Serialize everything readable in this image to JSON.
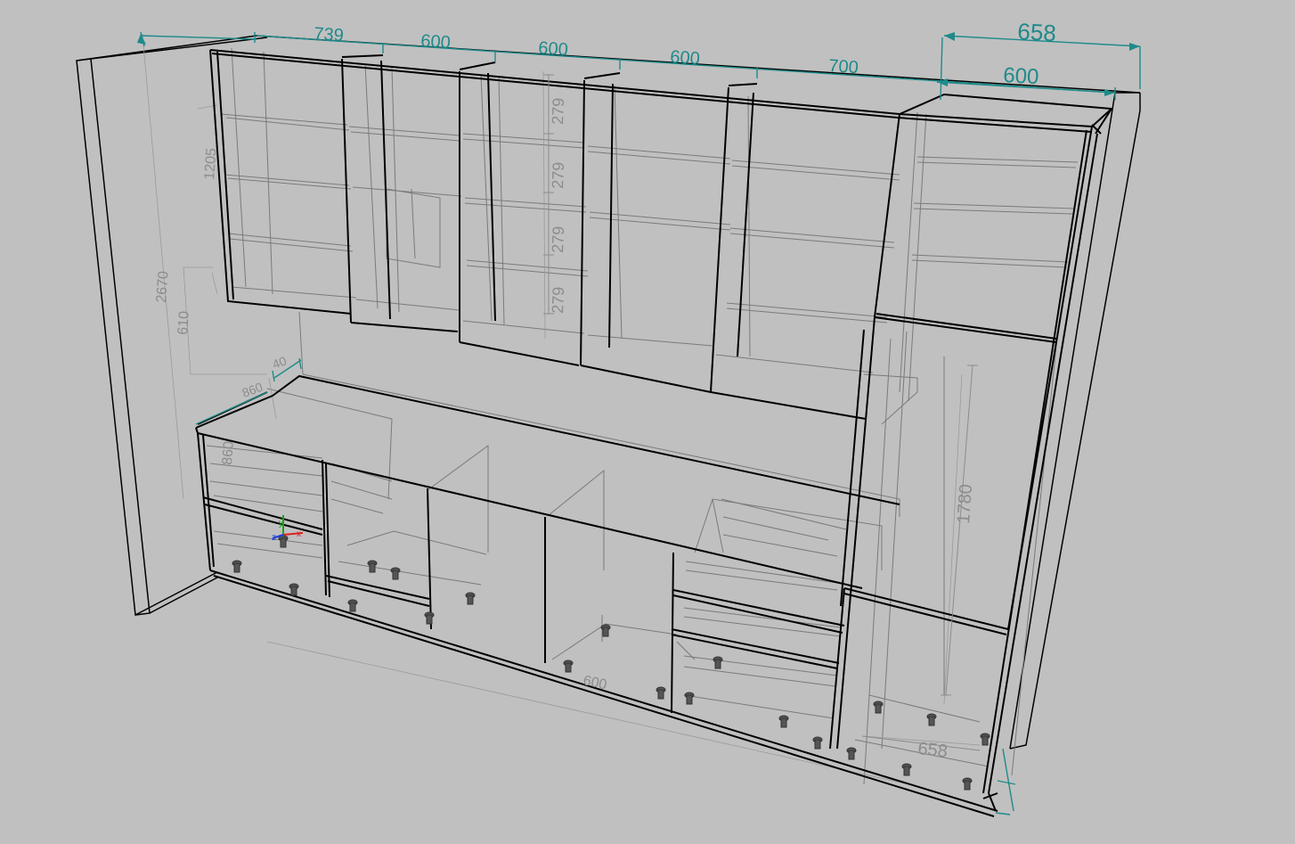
{
  "colors": {
    "background": "#c0c0c0",
    "edge_dark": "#000000",
    "edge_mid": "#1e1e1e",
    "edge_hidden": "#7a7a7a",
    "edge_faint": "#9a9a9a",
    "dimension_primary": "#1f8a8a",
    "dimension_secondary": "#8c8c8c",
    "axis_x": "#e02020",
    "axis_y": "#18a018",
    "axis_z": "#2040e0"
  },
  "dimensions_top": {
    "d1": "739",
    "d2": "600",
    "d3": "600",
    "d4": "600",
    "d5": "700",
    "d6": "658",
    "d7": "600"
  },
  "dimensions_side": {
    "total_height": "2670",
    "upper_height": "1205",
    "gap_height": "610",
    "base_depth_a": "860",
    "base_depth_b": "860",
    "base_height": "860",
    "countertop_thickness": "40",
    "shelf_1": "279",
    "shelf_2": "279",
    "shelf_3": "279",
    "shelf_4": "279",
    "tall_unit_height": "1780",
    "tall_unit_depth": "658",
    "plinth_depth": "600"
  },
  "axis_gizmo": {
    "x_label": "x",
    "y_label": "y",
    "z_label": "z",
    "icon": "axis-gizmo-icon"
  }
}
